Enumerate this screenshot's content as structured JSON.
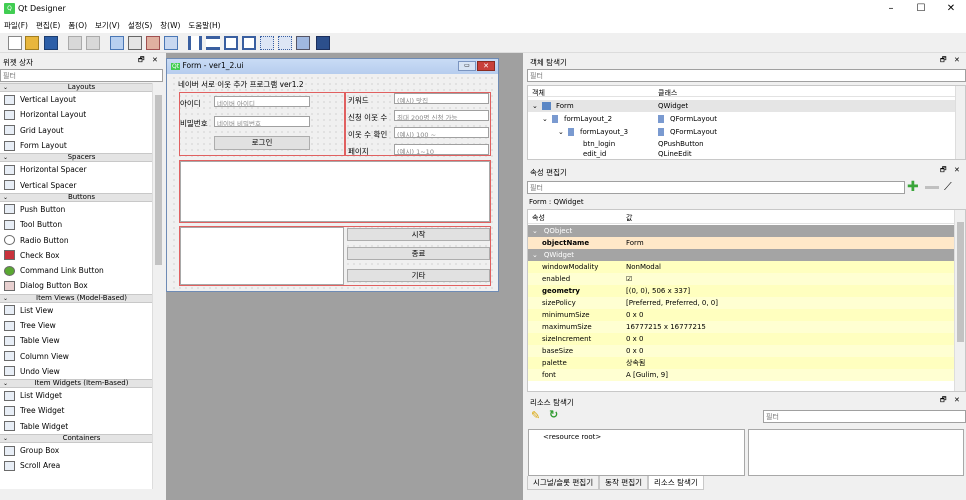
{
  "app": {
    "title": "Qt Designer",
    "icon": "qt-logo-icon"
  },
  "menu": [
    "파일(F)",
    "편집(E)",
    "폼(O)",
    "보기(V)",
    "설정(S)",
    "창(W)",
    "도움말(H)"
  ],
  "widget_box": {
    "title": "위젯 상자",
    "filter_placeholder": "필터",
    "categories": [
      {
        "label": "Layouts",
        "items": [
          "Vertical Layout",
          "Horizontal Layout",
          "Grid Layout",
          "Form Layout"
        ]
      },
      {
        "label": "Spacers",
        "items": [
          "Horizontal Spacer",
          "Vertical Spacer"
        ]
      },
      {
        "label": "Buttons",
        "items": [
          "Push Button",
          "Tool Button",
          "Radio Button",
          "Check Box",
          "Command Link Button",
          "Dialog Button Box"
        ]
      },
      {
        "label": "Item Views (Model-Based)",
        "items": [
          "List View",
          "Tree View",
          "Table View",
          "Column View",
          "Undo View"
        ]
      },
      {
        "label": "Item Widgets (Item-Based)",
        "items": [
          "List Widget",
          "Tree Widget",
          "Table Widget"
        ]
      },
      {
        "label": "Containers",
        "items": [
          "Group Box",
          "Scroll Area"
        ]
      }
    ]
  },
  "form": {
    "window_title": "Form - ver1_2.ui",
    "logo": "Qt",
    "heading": "네이버 서로 이웃 추가 프로그램 ver1.2",
    "id_label": "아이디",
    "id_placeholder": "네이버 아이디",
    "pw_label": "비밀번호",
    "pw_placeholder": "네이버 비밀번호",
    "login_button": "로그인",
    "keyword_label": "키워드",
    "keyword_placeholder": "(예시) 맛집",
    "req_label": "신청 이웃 수",
    "req_placeholder": "최대 200명 신청 가능",
    "check_label": "이웃 수 확인",
    "check_placeholder": "(예시) 100 ~",
    "page_label": "페이지",
    "page_placeholder": "(예시) 1~10",
    "start_button": "시작",
    "end_button": "종료",
    "etc_button": "기타"
  },
  "object_inspector": {
    "title": "객체 탐색기",
    "filter_placeholder": "필터",
    "col_object": "객체",
    "col_class": "클래스",
    "rows": [
      {
        "name": "Form",
        "class": "QWidget"
      },
      {
        "name": "formLayout_2",
        "class": "QFormLayout"
      },
      {
        "name": "formLayout_3",
        "class": "QFormLayout"
      },
      {
        "name": "btn_login",
        "class": "QPushButton"
      },
      {
        "name": "edit_id",
        "class": "QLineEdit"
      }
    ]
  },
  "property_editor": {
    "title": "속성 편집기",
    "filter_placeholder": "필터",
    "object_line": "Form : QWidget",
    "col_prop": "속성",
    "col_value": "값",
    "group1": "QObject",
    "objectName_key": "objectName",
    "objectName_val": "Form",
    "group2": "QWidget",
    "rows": [
      {
        "k": "windowModality",
        "v": "NonModal"
      },
      {
        "k": "enabled",
        "v": "☑"
      },
      {
        "k": "geometry",
        "v": "[(0, 0), 506 x 337]"
      },
      {
        "k": "sizePolicy",
        "v": "[Preferred, Preferred, 0, 0]"
      },
      {
        "k": "minimumSize",
        "v": "0 x 0"
      },
      {
        "k": "maximumSize",
        "v": "16777215 x 16777215"
      },
      {
        "k": "sizeIncrement",
        "v": "0 x 0"
      },
      {
        "k": "baseSize",
        "v": "0 x 0"
      },
      {
        "k": "palette",
        "v": "상속됨"
      },
      {
        "k": "font",
        "v": "A  [Gulim, 9]"
      }
    ]
  },
  "resource_browser": {
    "title": "리소스 탐색기",
    "filter_placeholder": "필터",
    "root": "<resource root>"
  },
  "bottom_tabs": [
    "시그널/슬롯 편집기",
    "동작 편집기",
    "리소스 탐색기"
  ]
}
